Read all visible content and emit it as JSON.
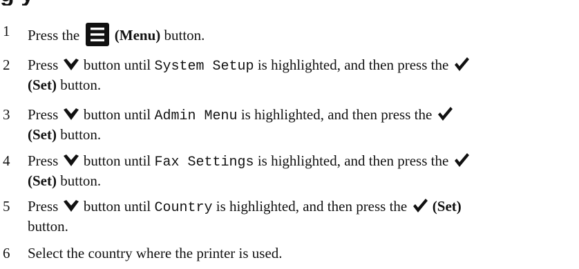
{
  "heading_fragment": "g                    y",
  "steps": [
    {
      "num": "1",
      "t1": "Press the",
      "icon1": "menu-icon",
      "label1": "(Menu)",
      "t2": "button."
    },
    {
      "num": "2",
      "t1": "Press",
      "icon1": "down-arrow-icon",
      "t2": "button until",
      "item": "System Setup",
      "t3": "is highlighted, and then press the",
      "icon2": "checkmark-icon",
      "label": "(Set)",
      "t4": "button."
    },
    {
      "num": "3",
      "t1": "Press",
      "icon1": "down-arrow-icon",
      "t2": "button until",
      "item": "Admin Menu",
      "t3": "is highlighted, and then press the",
      "icon2": "checkmark-icon",
      "label": "(Set)",
      "t4": "button."
    },
    {
      "num": "4",
      "t1": "Press",
      "icon1": "down-arrow-icon",
      "t2": "button until",
      "item": "Fax Settings",
      "t3": "is highlighted, and then press the",
      "icon2": "checkmark-icon",
      "label": "(Set)",
      "t4": "button."
    },
    {
      "num": "5",
      "t1": "Press",
      "icon1": "down-arrow-icon",
      "t2": "button until",
      "item": "Country",
      "t3": "is highlighted, and then press the",
      "icon2": "checkmark-icon",
      "label": "(Set)",
      "t4": "button."
    },
    {
      "num": "6",
      "t1": "Select the country where the printer is used."
    }
  ],
  "colors": {
    "text": "#111111",
    "background": "#ffffff"
  }
}
